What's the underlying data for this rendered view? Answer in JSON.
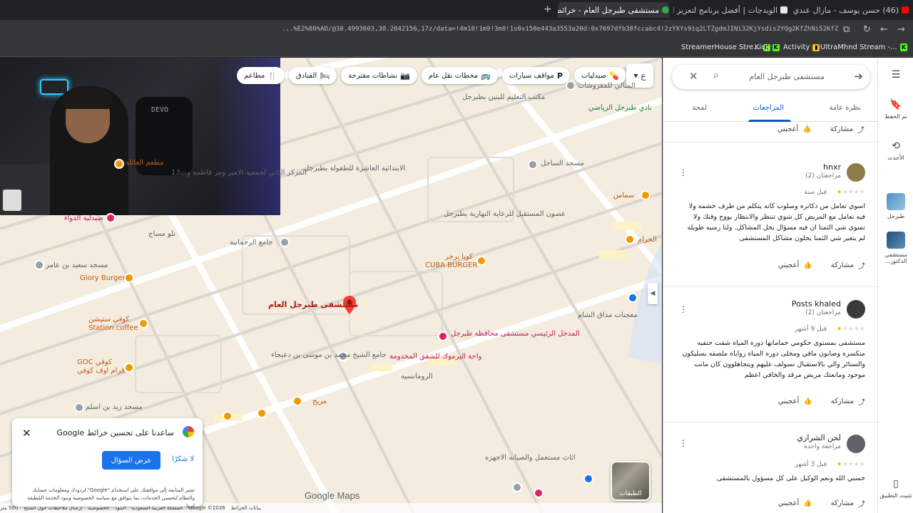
{
  "browser": {
    "tabs": [
      {
        "title": "(46) حسن يوسف - مازال عندي الـ",
        "active": false
      },
      {
        "title": "الويدجات | أفضل برنامج لتعزيز ا",
        "active": false
      },
      {
        "title": "مستشفى طبرجل العام - خرائط Goo",
        "active": true
      }
    ],
    "new_tab": "+",
    "url": "...%E2%80%AD/@30.4993603,38.2042156,17z/data=!4m18!1m9!3m8!1s0x150e443a3553a20d:0x7697dfb38fccabc4!2zYXYs9iq2LTZgdmJINi32KjYsdis2YQg2KfZhNi52KfZhQ!8m2!3d30.49...",
    "bookmarks": [
      {
        "label": "StreamerHouse Stre..."
      },
      {
        "label": "Kick"
      },
      {
        "label": "Activity"
      },
      {
        "label": "UltraMhnd Stream -..."
      }
    ]
  },
  "map": {
    "filters": [
      {
        "label": "مطاعم",
        "icon": "🍴"
      },
      {
        "label": "الفنادق",
        "icon": "🛏"
      },
      {
        "label": "نشاطات مقترحة",
        "icon": "📷"
      },
      {
        "label": "محطات نقل عام",
        "icon": "🚌"
      },
      {
        "label": "مواقف سيارات",
        "icon": "P"
      },
      {
        "label": "صيدليات",
        "icon": "💊"
      }
    ],
    "layer_toggle": "ع",
    "main_place": "مستشفى طبرجل العام",
    "places": [
      {
        "name": "مكتب التعليم للبنين بطبرجل",
        "type": "gray"
      },
      {
        "name": "المثالي للمفروشات",
        "type": "gray"
      },
      {
        "name": "نادي طبرجل الرياضي",
        "type": "green"
      },
      {
        "name": "مطعم العائلة",
        "type": "orange"
      },
      {
        "name": "المركز الثاني لجمعية الامير ومر فاطمه وث13",
        "type": "gray"
      },
      {
        "name": "الابتدائية العاشرة للطفولة بطبرجل",
        "type": "gray"
      },
      {
        "name": "مسجد الساحل",
        "type": "gray"
      },
      {
        "name": "سماس",
        "type": "orange"
      },
      {
        "name": "صيدلية الدواء",
        "type": "pink"
      },
      {
        "name": "نلو مساج",
        "type": "gray"
      },
      {
        "name": "جامع الرحمانية",
        "type": "gray"
      },
      {
        "name": "عصون المستقبل للرعاية النهارية بطبرجل",
        "type": "gray"
      },
      {
        "name": "الحرام",
        "type": "orange"
      },
      {
        "name": "مسجد سعيد بن عامر",
        "type": "gray"
      },
      {
        "name": "Glory Burger",
        "type": "orange"
      },
      {
        "name": "كوبا برجر",
        "type": "orange"
      },
      {
        "name": "CUBA BURGER",
        "type": "orange"
      },
      {
        "name": "كوفي ستيشن",
        "type": "orange"
      },
      {
        "name": "Station coffee",
        "type": "orange"
      },
      {
        "name": "المدخل الرئيسي مستشفى محافظه طبرجل",
        "type": "pink"
      },
      {
        "name": "معجنات مذاق الشام",
        "type": "gray"
      },
      {
        "name": "جامع الشيخ محمد بن موسى بن دعيجاء",
        "type": "gray"
      },
      {
        "name": "واحة اليرموك للشقق المخدومة",
        "type": "pink"
      },
      {
        "name": "كوفي GOC",
        "type": "orange"
      },
      {
        "name": "قرام اوف كوفي",
        "type": "orange"
      },
      {
        "name": "الرومانسيه",
        "type": "gray"
      },
      {
        "name": "مريح",
        "type": "orange"
      },
      {
        "name": "مسجد زيد بن اسلم",
        "type": "gray"
      },
      {
        "name": "اثاث مستعمل والصيانه الاجهزه",
        "type": "gray"
      }
    ],
    "satellite_label": "الطبقات",
    "logo": "Google Maps",
    "footer": [
      "بيانات الخرائط",
      "Google ©2026",
      "المملكة العربية السعودية",
      "البنود",
      "الخصوصية",
      "إرسال ملاحظات حول المنتج",
      "500 متر"
    ]
  },
  "survey": {
    "title": "ساعدنا على تحسين خرائط Google",
    "primary": "عرض السؤال",
    "secondary": "لا شكرًا",
    "fine_print": "تعتبر المتابعة إلى موافقتك على استخدام \"Google\" لردودك ومعلومات حسابك والنظام لتحسين الخدمات، بما يتوافق مع سياسة الخصوصية وبنود الخدمة المُطبقة لدينا."
  },
  "panel": {
    "search_value": "مستشفى طبرجل العام",
    "tabs": [
      "نظرة عامة",
      "المراجعات",
      "لمحة"
    ],
    "active_tab": "المراجعات",
    "like_label": "أعجبني",
    "share_label": "مشاركة",
    "reviews": [
      {
        "name": "hnxr",
        "meta": "مراجعتان (2)",
        "stars": 1,
        "when": "قبل سنة",
        "body": "اسوي تعامل من دكاتره وسلوب كانه يتكلم من طرف خشمه ولا فيه تعامل مع المريض كل شوي تنتظر والانتظار يووج وقتك ولا تسوي شي الثمنا ان فيه مسؤال يحل المشاكل. ولنا زمنيه طويله لم يتغير شي الثمنا يحلون مشاكل المستشفى"
      },
      {
        "name": "Posts khaled",
        "meta": "مراجعتان (2)",
        "stars": 1,
        "when": "قبل 9 أشهر",
        "body": "مستشفى بمستوى حكومي حماماتها دوره المياه شفت حنفيه منكسره وصابون مافي ومجلى دوره المياه زواياه ملصقه بسليكون والستائر والي بالاستقبال تسولف عليهم ويتجاهلوون كان مانت موجود ومانعتك مريض مرقد والخافي اعظم"
      },
      {
        "name": "لحن الشراري",
        "meta": "مراجعة واحدة",
        "stars": 1,
        "when": "قبل 3 أشهر",
        "body": "حسبي الله ونعم الوكيل على كل مسؤول بالمستشفى"
      }
    ]
  },
  "rail": {
    "saved": "تم الحفظ",
    "recent": "الأحدث",
    "recent_items": [
      "طبرجل",
      "مستشفى الدكتور..."
    ],
    "install": "تثبيت التطبيق"
  },
  "colors": {
    "accent": "#0b57d0",
    "star": "#fbbc04",
    "map_bg": "#f3ecdf"
  }
}
